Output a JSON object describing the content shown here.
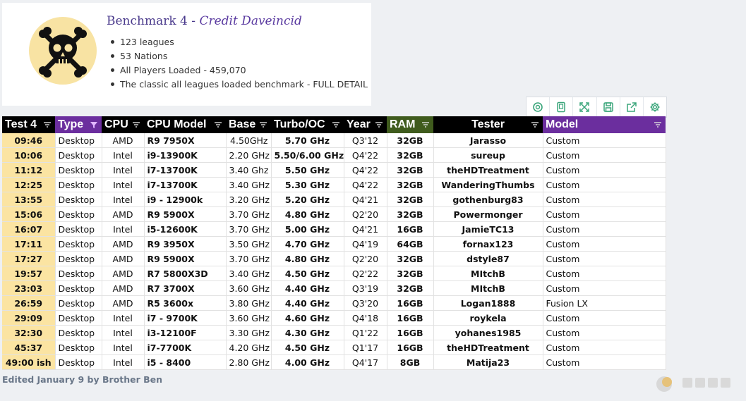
{
  "banner": {
    "title": "Benchmark 4 - ",
    "credit": "Credit Daveincid",
    "bullets": [
      "123 leagues",
      "53 Nations",
      "All Players Loaded - 459,070",
      "The classic all leagues loaded benchmark - FULL DETAIL"
    ],
    "logo_icon": "skull-crossbones-icon"
  },
  "toolbar": {
    "icons": [
      "search-icon",
      "page-icon",
      "expand-icon",
      "save-icon",
      "share-icon",
      "gear-icon"
    ]
  },
  "table": {
    "headers": [
      "Test 4",
      "Type",
      "CPU",
      "CPU Model",
      "Base",
      "Turbo/OC",
      "Year",
      "RAM",
      "Tester",
      "Model"
    ],
    "header_colors": [
      "#000000",
      "#6b2e9e",
      "#000000",
      "#000000",
      "#000000",
      "#000000",
      "#000000",
      "#3f5b1d",
      "#000000",
      "#6b2e9e"
    ],
    "rows": [
      [
        "09:46",
        "Desktop",
        "AMD",
        "R9 7950X",
        "4.50GHz",
        "5.70 GHz",
        "Q3'12",
        "32GB",
        "Jarasso",
        "Custom"
      ],
      [
        "10:06",
        "Desktop",
        "Intel",
        "i9-13900K",
        "2.20 GHz",
        "5.50/6.00 GHz",
        "Q4'22",
        "32GB",
        "sureup",
        "Custom"
      ],
      [
        "11:12",
        "Desktop",
        "Intel",
        "i7-13700K",
        "3.40 Ghz",
        "5.50 GHz",
        "Q4'22",
        "32GB",
        "theHDTreatment",
        "Custom"
      ],
      [
        "12:25",
        "Desktop",
        "Intel",
        "i7-13700K",
        "3.40 GHz",
        "5.30 GHz",
        "Q4'22",
        "32GB",
        "WanderingThumbs",
        "Custom"
      ],
      [
        "13:55",
        "Desktop",
        "Intel",
        "i9 - 12900k",
        "3.20 GHz",
        "5.20 GHz",
        "Q4'21",
        "32GB",
        "gothenburg83",
        "Custom"
      ],
      [
        "15:06",
        "Desktop",
        "AMD",
        "R9 5900X",
        "3.70 GHz",
        "4.80 GHz",
        "Q2'20",
        "32GB",
        "Powermonger",
        "Custom"
      ],
      [
        "16:07",
        "Desktop",
        "Intel",
        "i5-12600K",
        "3.70 GHz",
        "5.00 GHz",
        "Q4'21",
        "16GB",
        "JamieTC13",
        "Custom"
      ],
      [
        "17:11",
        "Desktop",
        "AMD",
        "R9 3950X",
        "3.50 GHz",
        "4.70 GHz",
        "Q4'19",
        "64GB",
        "fornax123",
        "Custom"
      ],
      [
        "17:27",
        "Desktop",
        "AMD",
        "R9 5900X",
        "3.70 GHz",
        "4.80 GHz",
        "Q2'20",
        "32GB",
        "dstyle87",
        "Custom"
      ],
      [
        "19:57",
        "Desktop",
        "AMD",
        "R7 5800X3D",
        "3.40 GHz",
        "4.50 GHz",
        "Q2'22",
        "32GB",
        "MItchB",
        "Custom"
      ],
      [
        "23:03",
        "Desktop",
        "AMD",
        "R7 3700X",
        "3.60 GHz",
        "4.40 GHz",
        "Q3'19",
        "32GB",
        "MItchB",
        "Custom"
      ],
      [
        "26:59",
        "Desktop",
        "AMD",
        "R5 3600x",
        "3.80 GHz",
        "4.40 GHz",
        "Q3'20",
        "16GB",
        "Logan1888",
        "Fusion LX"
      ],
      [
        "29:09",
        "Desktop",
        "Intel",
        "i7 - 9700K",
        "3.60 GHz",
        "4.60 GHz",
        "Q4'18",
        "16GB",
        "roykela",
        "Custom"
      ],
      [
        "32:30",
        "Desktop",
        "Intel",
        "i3-12100F",
        "3.30 GHz",
        "4.30 GHz",
        "Q1'22",
        "16GB",
        "yohanes1985",
        "Custom"
      ],
      [
        "45:37",
        "Desktop",
        "Intel",
        "i7-7700K",
        "4.20 GHz",
        "4.50 GHz",
        "Q1'17",
        "16GB",
        "theHDTreatment",
        "Custom"
      ],
      [
        "49:00 ish",
        "Desktop",
        "Intel",
        "i5 - 8400",
        "2.80 GHz",
        "4.00 GHz",
        "Q4'17",
        "8GB",
        "Matija23",
        "Custom"
      ]
    ]
  },
  "footer": {
    "edited": "Edited January 9 by Brother Ben"
  }
}
